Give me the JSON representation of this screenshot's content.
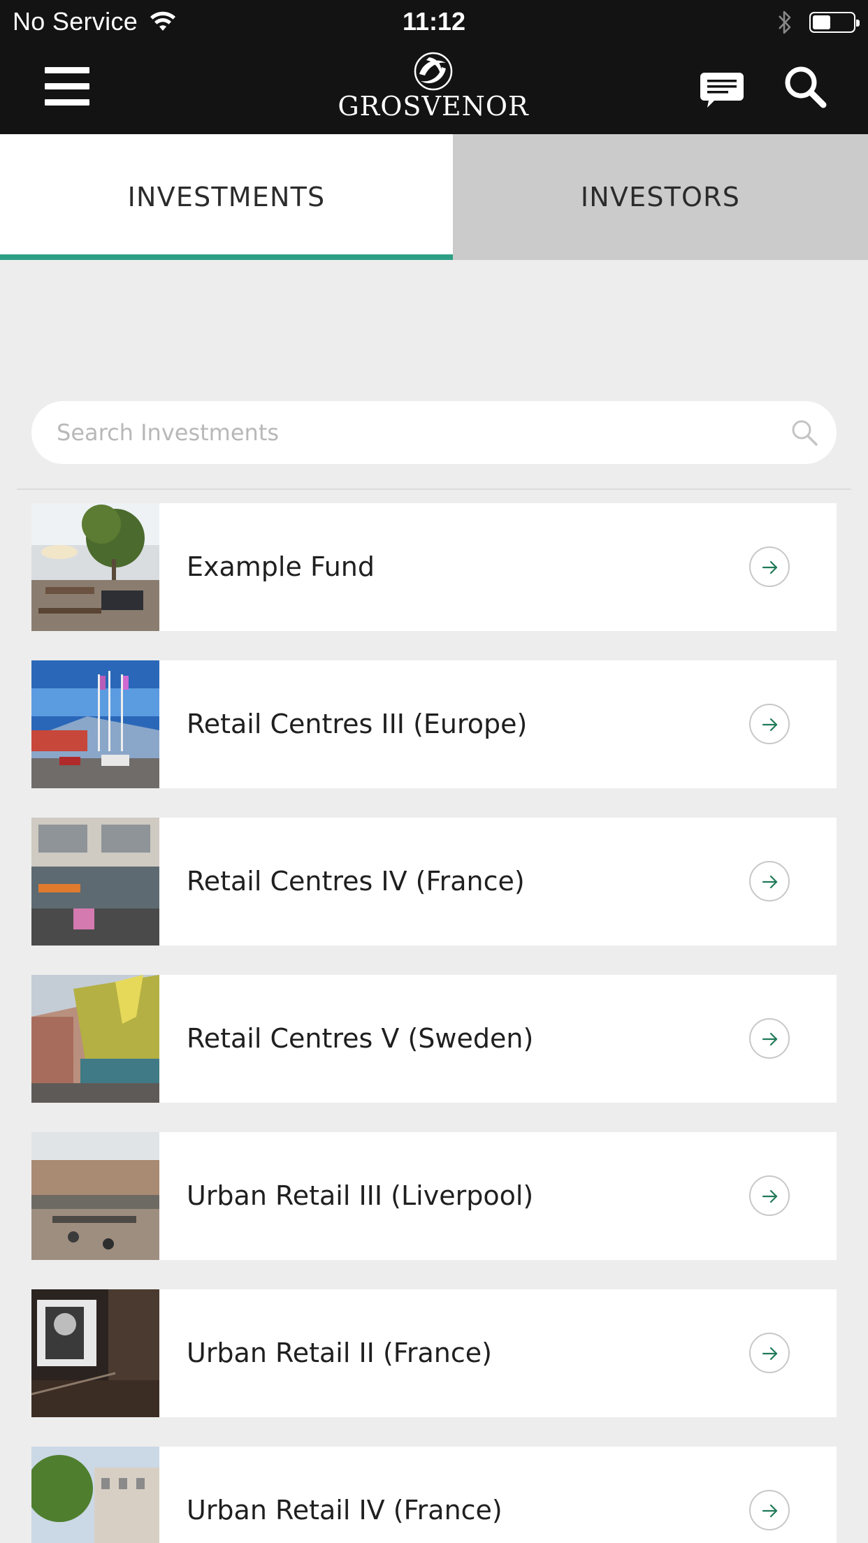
{
  "status_bar": {
    "carrier": "No Service",
    "time": "11:12",
    "battery_level": 0.45
  },
  "header": {
    "logo_text": "GROSVENOR",
    "icons": [
      "menu-icon",
      "chat-icon",
      "search-icon"
    ]
  },
  "tabs": [
    {
      "label": "INVESTMENTS",
      "active": true
    },
    {
      "label": "INVESTORS",
      "active": false
    }
  ],
  "search": {
    "placeholder": "Search Investments",
    "value": ""
  },
  "funds": [
    {
      "name": "Example Fund",
      "icon": "arrow-right-circle-icon"
    },
    {
      "name": "Retail Centres III (Europe)",
      "icon": "arrow-right-circle-icon"
    },
    {
      "name": "Retail Centres IV (France)",
      "icon": "arrow-right-circle-icon"
    },
    {
      "name": "Retail Centres V (Sweden)",
      "icon": "arrow-right-circle-icon"
    },
    {
      "name": "Urban Retail III (Liverpool)",
      "icon": "arrow-right-circle-icon"
    },
    {
      "name": "Urban Retail II (France)",
      "icon": "arrow-right-circle-icon"
    },
    {
      "name": "Urban Retail IV (France)",
      "icon": "arrow-right-circle-icon"
    }
  ],
  "colors": {
    "header_bg": "#131313",
    "accent": "#2d9f85",
    "arrow": "#1f7a57",
    "page_bg": "#ededed",
    "inactive_tab": "#cbcbcb"
  }
}
